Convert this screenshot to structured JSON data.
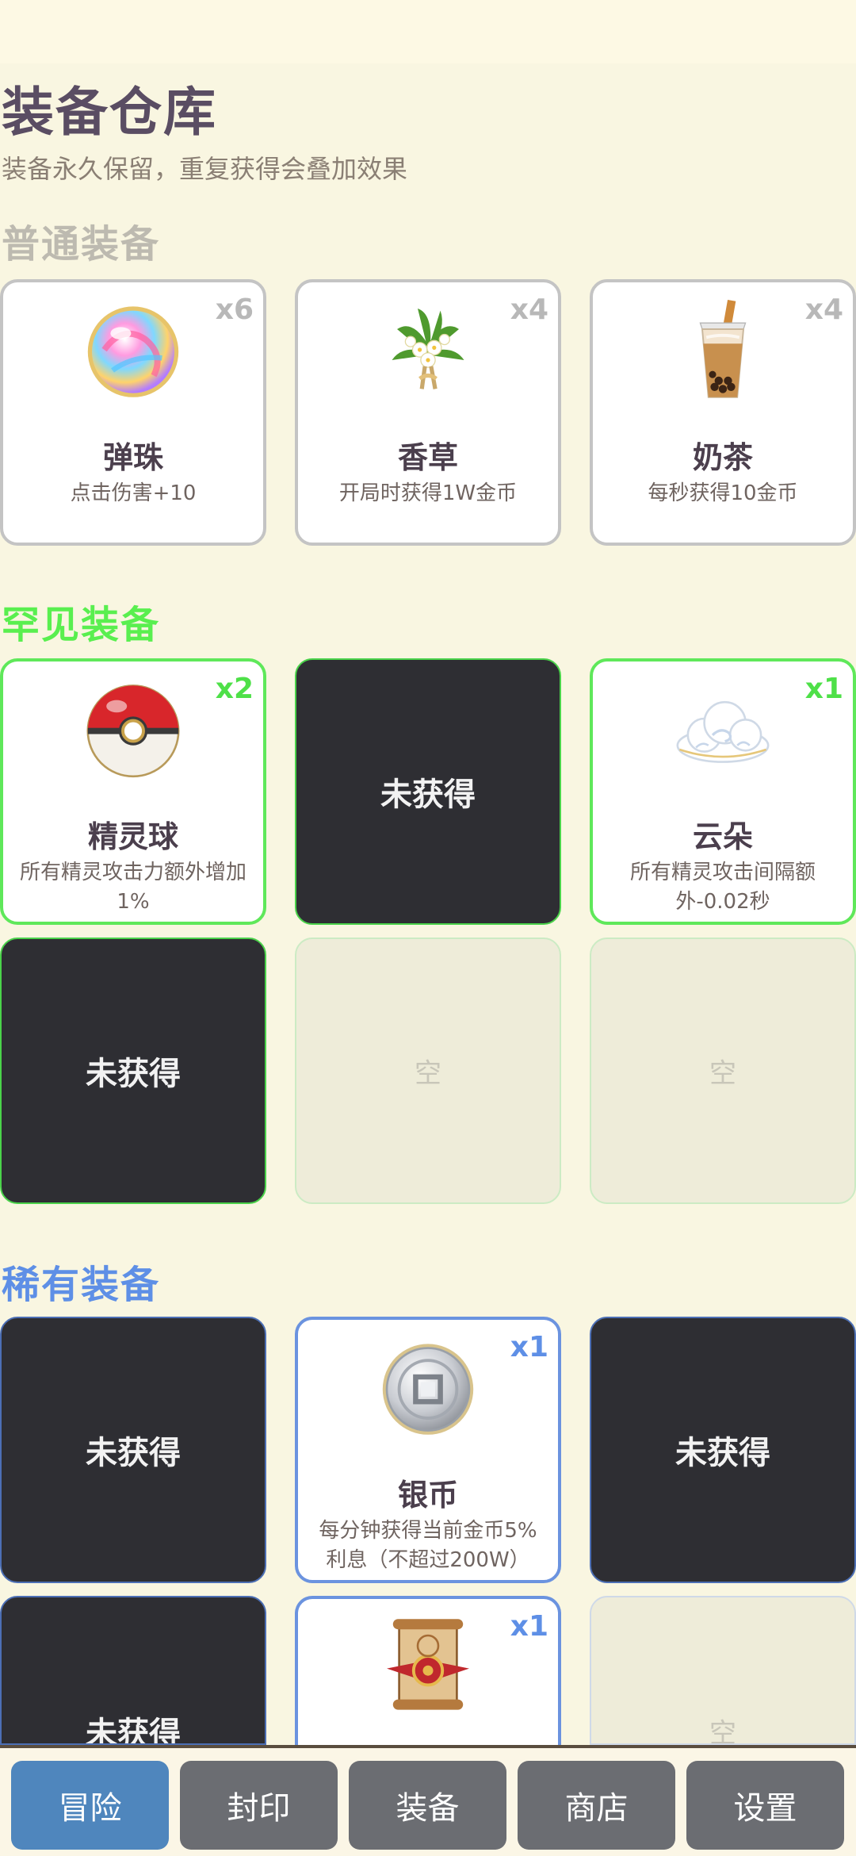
{
  "header": {
    "title": "装备仓库",
    "subtitle": "装备永久保留，重复获得会叠加效果"
  },
  "sections": {
    "common": {
      "title": "普通装备",
      "items": [
        {
          "name": "弹珠",
          "desc": "点击伤害+10",
          "count": "x6",
          "icon": "marble-icon"
        },
        {
          "name": "香草",
          "desc": "开局时获得1W金币",
          "count": "x4",
          "icon": "vanilla-flower-icon"
        },
        {
          "name": "奶茶",
          "desc": "每秒获得10金币",
          "count": "x4",
          "icon": "milk-tea-icon"
        }
      ]
    },
    "uncommon": {
      "title": "罕见装备",
      "items": [
        {
          "name": "精灵球",
          "desc": "所有精灵攻击力额外增加1%",
          "count": "x2",
          "icon": "pokeball-icon"
        },
        {
          "locked_label": "未获得"
        },
        {
          "name": "云朵",
          "desc": "所有精灵攻击间隔额外-0.02秒",
          "count": "x1",
          "icon": "cloud-icon"
        },
        {
          "locked_label": "未获得"
        },
        {
          "empty_label": "空"
        },
        {
          "empty_label": "空"
        }
      ]
    },
    "rare": {
      "title": "稀有装备",
      "items": [
        {
          "locked_label": "未获得"
        },
        {
          "name": "银币",
          "desc": "每分钟获得当前金币5%利息（不超过200W）",
          "count": "x1",
          "icon": "silver-coin-icon"
        },
        {
          "locked_label": "未获得"
        },
        {
          "locked_label": "未获得"
        },
        {
          "count": "x1",
          "icon": "scroll-icon"
        },
        {
          "empty_label": "空"
        }
      ]
    }
  },
  "bottom_nav": {
    "items": [
      "冒险",
      "封印",
      "装备",
      "商店",
      "设置"
    ],
    "active": "冒险"
  },
  "colors": {
    "background": "#f9f6e1",
    "common": "#bdbab0",
    "uncommon": "#59ef4f",
    "rare": "#5e8fe6",
    "nav_active": "#4f86bd",
    "nav_inactive": "#6b6d72",
    "locked_card": "#2e2e33"
  }
}
